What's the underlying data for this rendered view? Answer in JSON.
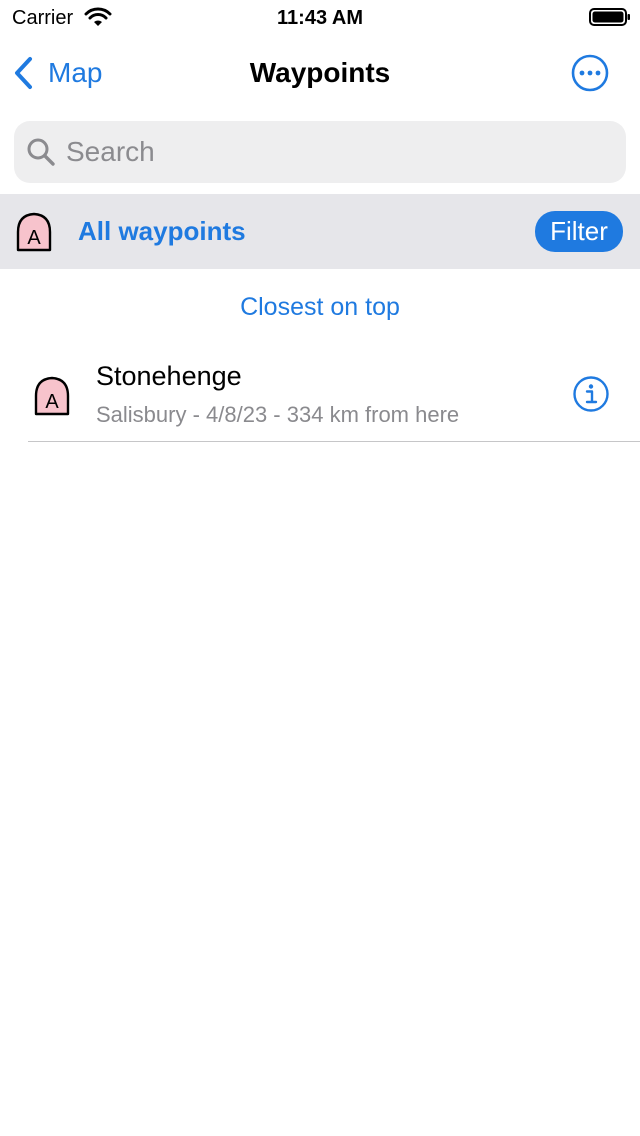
{
  "status_bar": {
    "carrier": "Carrier",
    "time": "11:43 AM"
  },
  "nav": {
    "back_label": "Map",
    "title": "Waypoints"
  },
  "search": {
    "placeholder": "Search",
    "value": ""
  },
  "filter_bar": {
    "label": "All waypoints",
    "button_label": "Filter",
    "icon_letter": "A"
  },
  "sort": {
    "label": "Closest on top"
  },
  "waypoints": [
    {
      "title": "Stonehenge",
      "subtitle": "Salisbury - 4/8/23 - 334 km from here",
      "icon_letter": "A"
    }
  ],
  "colors": {
    "accent": "#1f7ae0",
    "filter_bar_bg": "#e6e6ea",
    "search_bg": "#eeeeef",
    "waypoint_icon_fill": "#f7c3cc"
  },
  "icons": {
    "back": "chevron-left-icon",
    "more": "ellipsis-circle-icon",
    "search": "magnifier-icon",
    "waypoint": "waypoint-marker-icon",
    "info": "info-circle-icon",
    "wifi": "wifi-icon",
    "battery": "battery-icon"
  }
}
